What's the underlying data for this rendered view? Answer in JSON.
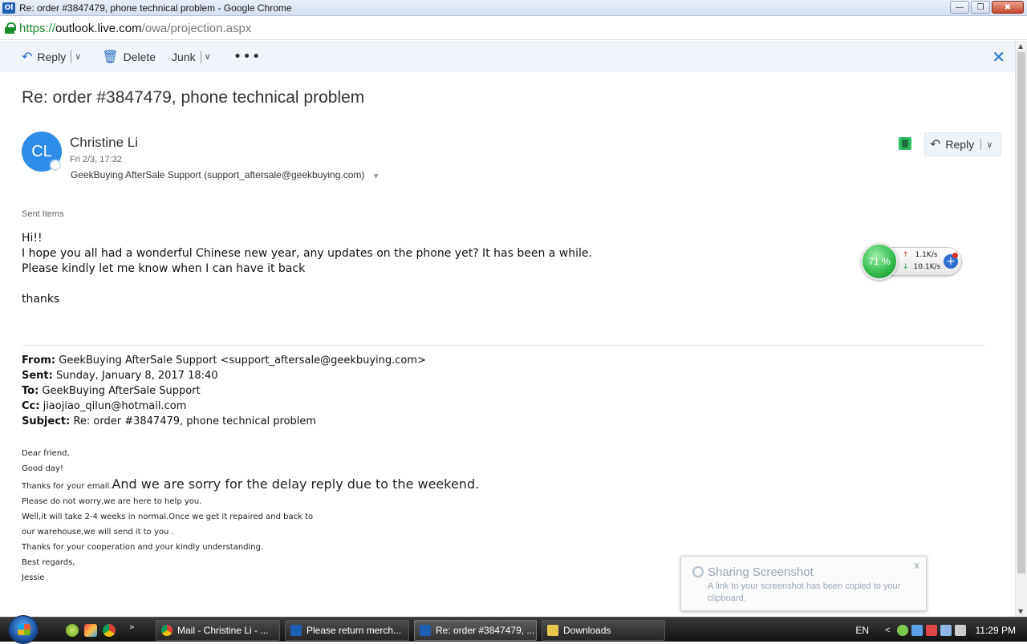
{
  "window": {
    "app_icon": "Ol",
    "title": "Re: order #3847479, phone technical problem - Google Chrome",
    "minimize": "―",
    "restore": "❐",
    "close": "✖"
  },
  "address": {
    "scheme": "https://",
    "host": "outlook.live.com",
    "path": "/owa/projection.aspx"
  },
  "toolbar": {
    "reply_label": "Reply",
    "delete_label": "Delete",
    "junk_label": "Junk",
    "more_label": "•••",
    "close_label": "✕"
  },
  "message": {
    "subject": "Re: order #3847479, phone technical problem",
    "avatar_initials": "CL",
    "sender_name": "Christine Li",
    "datetime": "Fri 2/3, 17:32",
    "recipient": "GeekBuying AfterSale Support (support_aftersale@geekbuying.com)",
    "reply_button": "Reply",
    "folder": "Sent Items",
    "body_lines": [
      "Hi!!",
      "I hope you all had a wonderful Chinese new year, any updates on the phone yet? It has been a while.",
      "Please kindly let me know when I can have it back",
      "thanks"
    ],
    "quoted_header": {
      "from_label": "From:",
      "from_value": " GeekBuying AfterSale Support <support_aftersale@geekbuying.com>",
      "sent_label": "Sent:",
      "sent_value": " Sunday, January 8, 2017 18:40",
      "to_label": "To:",
      "to_value": " GeekBuying AfterSale Support",
      "cc_label": "Cc:",
      "cc_value": " jiaojiao_qilun@hotmail.com",
      "subject_label": "Subject:",
      "subject_value": " Re: order #3847479, phone technical problem"
    },
    "quoted_body": {
      "line1": "Dear friend,",
      "line2": "Good day!",
      "line3_small": "Thanks for your email.",
      "line3_big": "And  we are sorry for the delay  reply due to the weekend.",
      "line4": "Please do not worry,we are here to help you.",
      "line5": "Well,it will take 2-4 weeks in normal.Once we get it repaired and back to",
      "line6": "our warehouse,we will send it to you .",
      "line7": "Thanks for your cooperation and your kindly understanding.",
      "line8": "Best regards,",
      "line9": "Jessie"
    }
  },
  "net_widget": {
    "percent": "71 %",
    "up_arrow": "↑",
    "up_speed": "1.1K/s",
    "down_arrow": "↓",
    "down_speed": "10.1K/s",
    "plus": "+"
  },
  "toast": {
    "title": "Sharing Screenshot",
    "message": "A link to your screenshot has been copied to your clipboard.",
    "close": "x"
  },
  "taskbar": {
    "quicklaunch_more": "»",
    "tasks": [
      {
        "label": "Mail - Christine Li - ...",
        "icon_color": "#e0a030"
      },
      {
        "label": "Please return merch...",
        "icon_color": "#1e5fb4"
      },
      {
        "label": "Re: order #3847479, ...",
        "icon_color": "#1e5fb4"
      },
      {
        "label": "Downloads",
        "icon_color": "#e6c84a"
      }
    ],
    "language": "EN",
    "tray_arrow": "<",
    "clock": "11:29 PM"
  },
  "colors": {
    "accent": "#2e8de6",
    "toolbar_bg": "#eff5fb",
    "link_green": "#1a8c2c"
  }
}
